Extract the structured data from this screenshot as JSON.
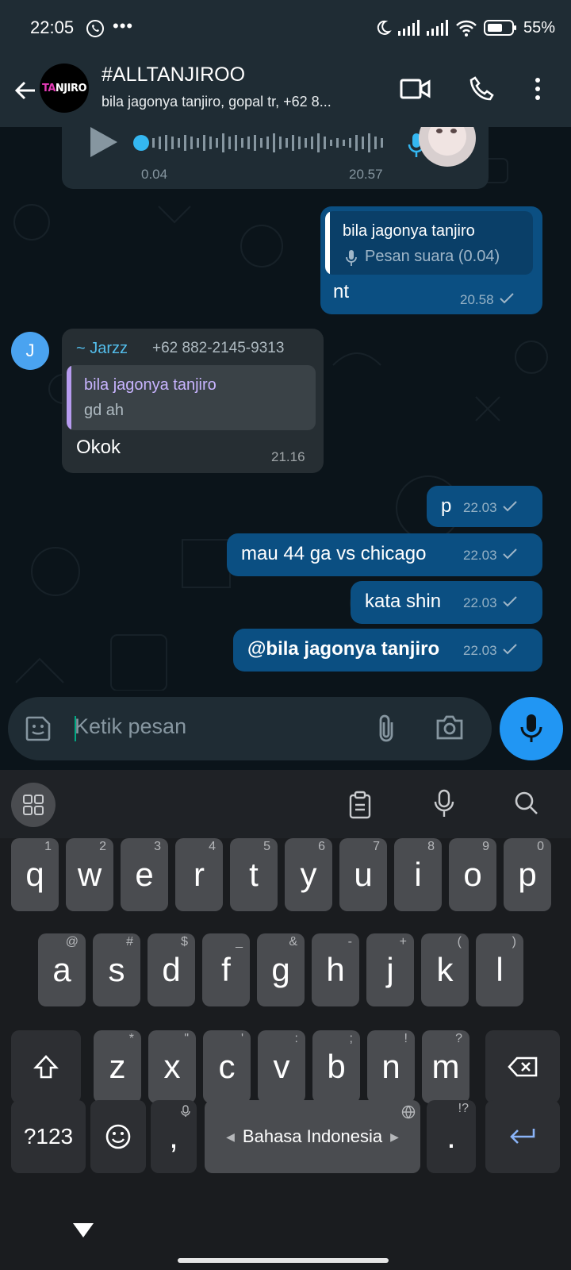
{
  "status_bar": {
    "time": "22:05",
    "more": "•••",
    "battery": "55%"
  },
  "header": {
    "title": "#ALLTANJIROO",
    "subtitle": "bila jagonya tanjiro, gopal tr, +62 8...",
    "avatar_text_accent": "TA",
    "avatar_text": "NJIRO"
  },
  "messages": {
    "voice": {
      "elapsed": "0.04",
      "time": "20.57"
    },
    "reply1": {
      "quote_author": "bila jagonya tanjiro",
      "quote_text": "Pesan suara (0.04)",
      "text": "nt",
      "time": "20.58"
    },
    "incoming": {
      "avatar_letter": "J",
      "sender_name": "~ Jarzz",
      "sender_phone": "+62 882-2145-9313",
      "quote_author": "bila jagonya tanjiro",
      "quote_text": "gd ah",
      "text": "Okok",
      "time": "21.16"
    },
    "out1": {
      "text": "p",
      "time": "22.03"
    },
    "out2": {
      "text": "mau 44 ga vs chicago",
      "time": "22.03"
    },
    "out3": {
      "text": "kata shin",
      "time": "22.03"
    },
    "out4": {
      "text": "@bila jagonya tanjiro",
      "time": "22.03"
    }
  },
  "composer": {
    "placeholder": "Ketik pesan"
  },
  "keyboard": {
    "row1": [
      {
        "k": "q",
        "a": "1"
      },
      {
        "k": "w",
        "a": "2"
      },
      {
        "k": "e",
        "a": "3"
      },
      {
        "k": "r",
        "a": "4"
      },
      {
        "k": "t",
        "a": "5"
      },
      {
        "k": "y",
        "a": "6"
      },
      {
        "k": "u",
        "a": "7"
      },
      {
        "k": "i",
        "a": "8"
      },
      {
        "k": "o",
        "a": "9"
      },
      {
        "k": "p",
        "a": "0"
      }
    ],
    "row2": [
      {
        "k": "a",
        "a": "@"
      },
      {
        "k": "s",
        "a": "#"
      },
      {
        "k": "d",
        "a": "$"
      },
      {
        "k": "f",
        "a": "_"
      },
      {
        "k": "g",
        "a": "&"
      },
      {
        "k": "h",
        "a": "-"
      },
      {
        "k": "j",
        "a": "+"
      },
      {
        "k": "k",
        "a": "("
      },
      {
        "k": "l",
        "a": ")"
      }
    ],
    "row3": [
      {
        "k": "z",
        "a": "*"
      },
      {
        "k": "x",
        "a": "\""
      },
      {
        "k": "c",
        "a": "'"
      },
      {
        "k": "v",
        "a": ":"
      },
      {
        "k": "b",
        "a": ";"
      },
      {
        "k": "n",
        "a": "!"
      },
      {
        "k": "m",
        "a": "?"
      }
    ],
    "symbols_label": "?123",
    "comma": ",",
    "space_label": "Bahasa Indonesia",
    "period": ".",
    "period_alt": "!?"
  }
}
